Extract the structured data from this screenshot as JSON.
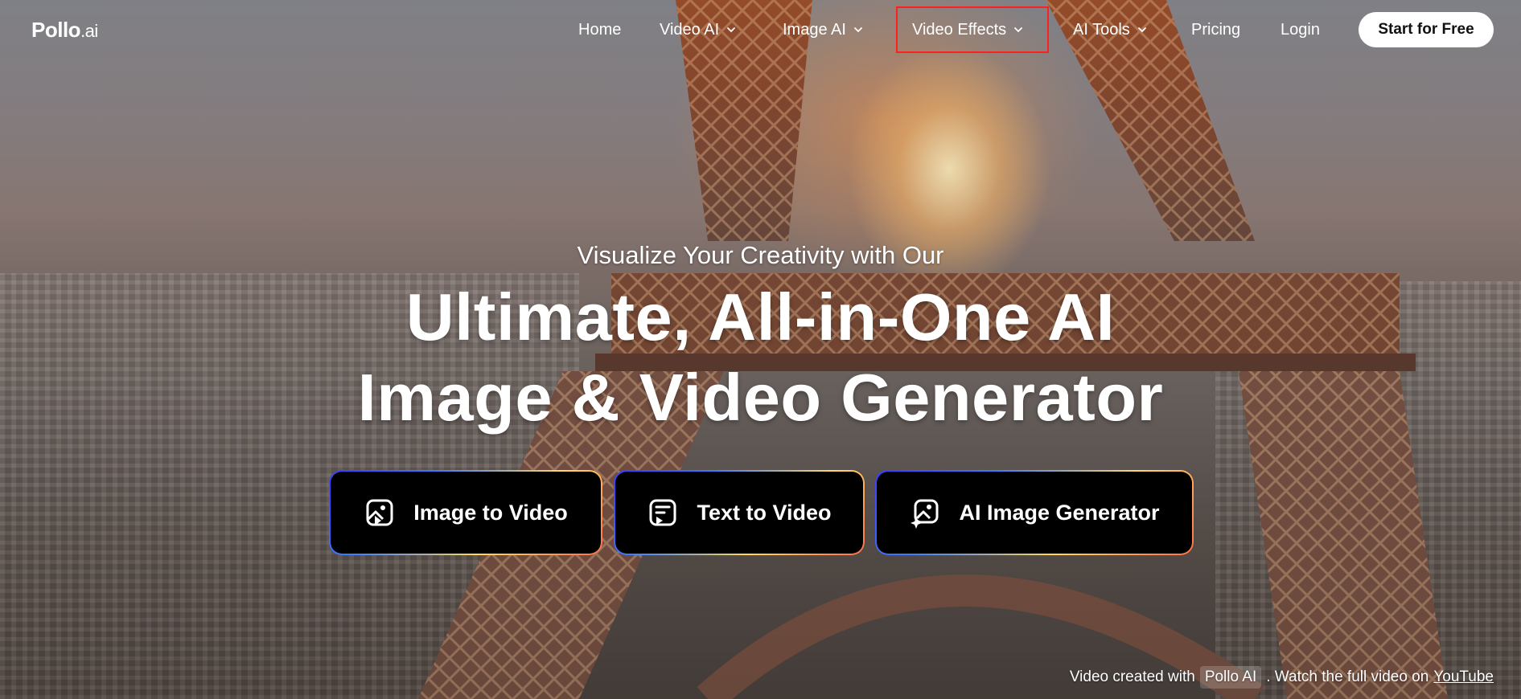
{
  "brand": {
    "logo_main": "Pollo",
    "logo_suffix": ".ai"
  },
  "nav": {
    "items": [
      {
        "label": "Home",
        "has_dropdown": false
      },
      {
        "label": "Video AI",
        "has_dropdown": true
      },
      {
        "label": "Image AI",
        "has_dropdown": true
      },
      {
        "label": "Video Effects",
        "has_dropdown": true,
        "highlighted": true
      },
      {
        "label": "AI Tools",
        "has_dropdown": true
      },
      {
        "label": "Pricing",
        "has_dropdown": false
      },
      {
        "label": "Login",
        "has_dropdown": false
      }
    ],
    "cta_label": "Start for Free",
    "highlight_color": "#ff1f1f"
  },
  "hero": {
    "subtitle": "Visualize Your Creativity with Our",
    "headline_line1": "Ultimate, All-in-One AI",
    "headline_line2": "Image & Video Generator"
  },
  "ctas": [
    {
      "label": "Image to Video",
      "icon": "image-video-icon"
    },
    {
      "label": "Text to Video",
      "icon": "text-video-icon"
    },
    {
      "label": "AI Image Generator",
      "icon": "ai-image-icon"
    }
  ],
  "caption": {
    "prefix": "Video created with",
    "chip": "Pollo AI",
    "middle": ". Watch the full video on",
    "link": "YouTube"
  }
}
